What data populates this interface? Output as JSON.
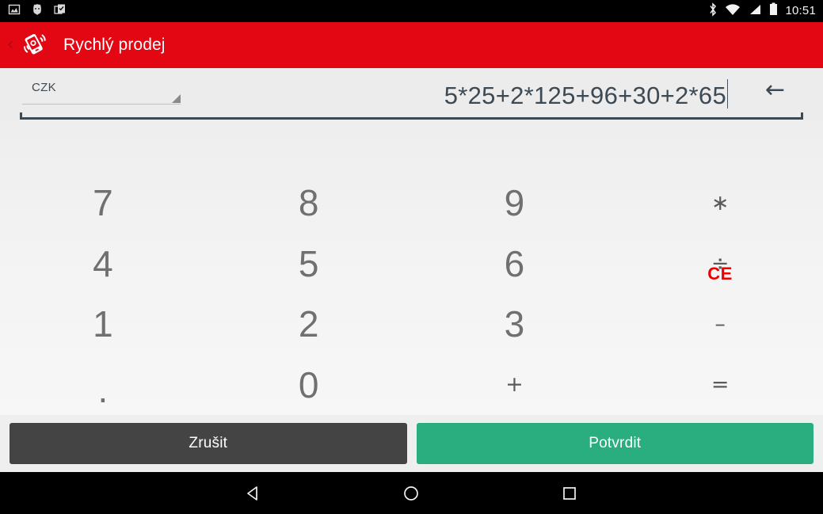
{
  "statusbar": {
    "time": "10:51",
    "left_icons": [
      "screenshot-icon",
      "usb-debug-icon",
      "clipboard-icon"
    ],
    "right_icons": [
      "bluetooth-icon",
      "wifi-icon",
      "signal-icon",
      "battery-icon"
    ]
  },
  "appbar": {
    "back_label": "‹",
    "logo_icon": "mobile-payment-logo-icon",
    "title": "Rychlý prodej",
    "color": "#e30613"
  },
  "input": {
    "currency": "CZK",
    "currency_options": [
      "CZK"
    ],
    "expression": "5*25+2*125+96+30+2*65",
    "backspace_label": "←",
    "backspace_icon": "backspace-arrow-icon",
    "spinner_icon": "dropdown-triangle-icon"
  },
  "keypad": {
    "clear_label": "CE",
    "clear_color": "#ee0000",
    "keys": [
      {
        "label": "7",
        "name": "key-7",
        "kind": "digit"
      },
      {
        "label": "8",
        "name": "key-8",
        "kind": "digit"
      },
      {
        "label": "9",
        "name": "key-9",
        "kind": "digit"
      },
      {
        "label": "∗",
        "name": "key-multiply",
        "kind": "op"
      },
      {
        "label": "4",
        "name": "key-4",
        "kind": "digit"
      },
      {
        "label": "5",
        "name": "key-5",
        "kind": "digit"
      },
      {
        "label": "6",
        "name": "key-6",
        "kind": "digit"
      },
      {
        "label": "÷",
        "name": "key-divide",
        "kind": "op"
      },
      {
        "label": "1",
        "name": "key-1",
        "kind": "digit"
      },
      {
        "label": "2",
        "name": "key-2",
        "kind": "digit"
      },
      {
        "label": "3",
        "name": "key-3",
        "kind": "digit"
      },
      {
        "label": "–",
        "name": "key-minus",
        "kind": "op"
      },
      {
        "label": ".",
        "name": "key-decimal",
        "kind": "dot"
      },
      {
        "label": "0",
        "name": "key-0",
        "kind": "digit"
      },
      {
        "label": "+",
        "name": "key-plus",
        "kind": "op"
      },
      {
        "label": "=",
        "name": "key-equals",
        "kind": "op"
      }
    ]
  },
  "actions": {
    "cancel_label": "Zrušit",
    "cancel_color": "#444444",
    "confirm_label": "Potvrdit",
    "confirm_color": "#2aae7f"
  },
  "navbar": {
    "back_icon": "nav-back-triangle-icon",
    "home_icon": "nav-home-circle-icon",
    "recents_icon": "nav-recents-square-icon"
  }
}
